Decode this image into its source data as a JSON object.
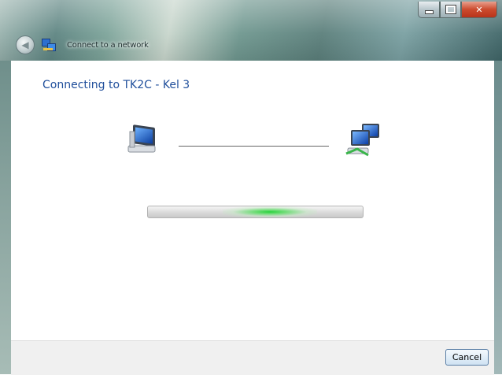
{
  "window": {
    "title": "Connect to a network",
    "caption_buttons": [
      "minimize",
      "maximize",
      "close"
    ],
    "accent_color": "#1f4e9b"
  },
  "nav": {
    "back_icon": "back-arrow-icon",
    "app_icon": "network-icon"
  },
  "content": {
    "heading": "Connecting to TK2C - Kel 3",
    "left_icon": "computer-icon",
    "right_icon": "network-computers-icon",
    "progress": {
      "state": "indeterminate",
      "color": "#28d23c"
    }
  },
  "footer": {
    "cancel_label": "Cancel"
  }
}
